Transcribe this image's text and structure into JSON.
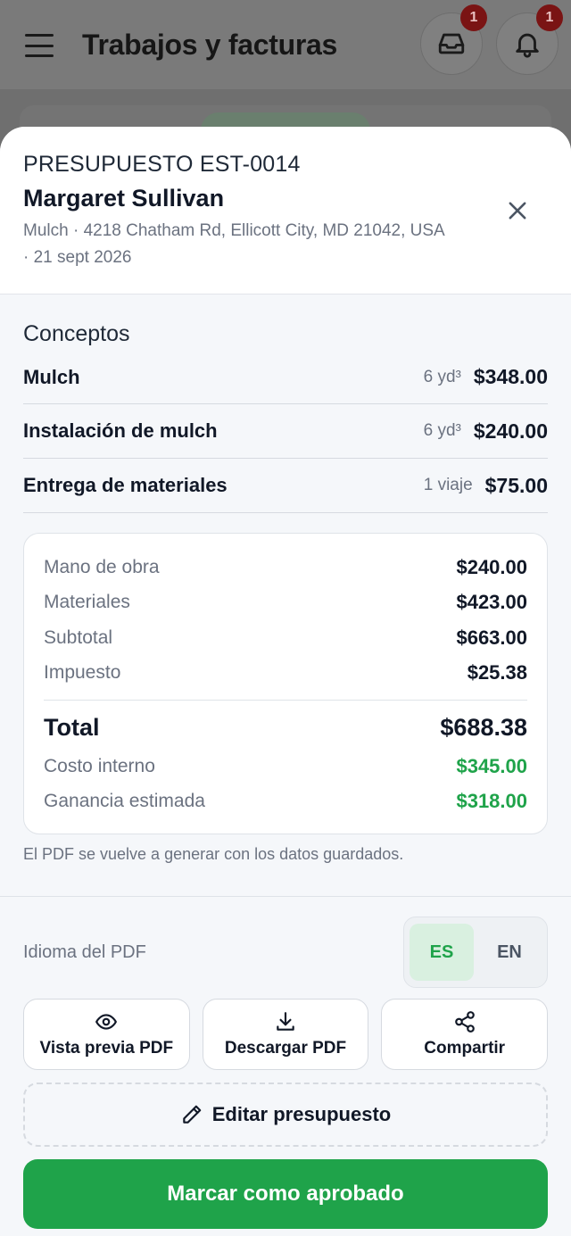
{
  "app_header": {
    "title": "Trabajos y facturas",
    "inbox_badge": "1",
    "bell_badge": "1"
  },
  "estimate": {
    "eyebrow": "PRESUPUESTO EST-0014",
    "client": "Margaret Sullivan",
    "meta": "Mulch · 4218 Chatham Rd, Ellicott City, MD 21042, USA · 21 sept 2026"
  },
  "items_section": {
    "title": "Conceptos",
    "items": [
      {
        "name": "Mulch",
        "qty": "6 yd³",
        "price": "$348.00"
      },
      {
        "name": "Instalación de mulch",
        "qty": "6 yd³",
        "price": "$240.00"
      },
      {
        "name": "Entrega de materiales",
        "qty": "1 viaje",
        "price": "$75.00"
      }
    ]
  },
  "totals": {
    "labor": {
      "label": "Mano de obra",
      "value": "$240.00"
    },
    "materials": {
      "label": "Materiales",
      "value": "$423.00"
    },
    "subtotal": {
      "label": "Subtotal",
      "value": "$663.00"
    },
    "tax": {
      "label": "Impuesto",
      "value": "$25.38"
    },
    "total": {
      "label": "Total",
      "value": "$688.38"
    },
    "internal_cost": {
      "label": "Costo interno",
      "value": "$345.00"
    },
    "est_profit": {
      "label": "Ganancia estimada",
      "value": "$318.00"
    }
  },
  "note": "El PDF se vuelve a generar con los datos guardados.",
  "pdf_language": {
    "label": "Idioma del PDF",
    "options": [
      "ES",
      "EN"
    ],
    "selected": "ES"
  },
  "actions": {
    "preview": "Vista previa PDF",
    "download": "Descargar PDF",
    "share": "Compartir"
  },
  "edit_label": "Editar presupuesto",
  "approve_label": "Marcar como aprobado",
  "colors": {
    "accent_green": "#1fa34a",
    "active_toggle_bg": "#d9f0e0",
    "badge_red": "#7a1414"
  },
  "icons": {
    "menu": "menu-icon",
    "inbox": "inbox-icon",
    "bell": "bell-icon",
    "close": "close-icon",
    "eye": "eye-icon",
    "download": "download-icon",
    "share": "share-icon",
    "pencil": "pencil-icon"
  }
}
